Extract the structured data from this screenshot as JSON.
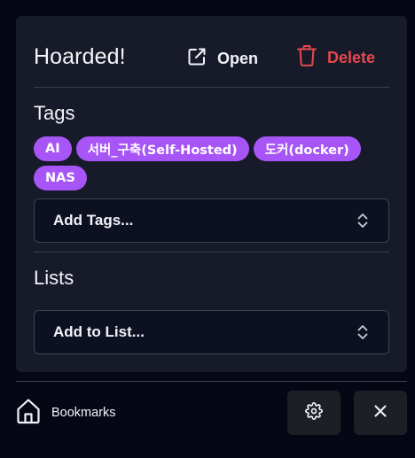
{
  "header": {
    "title": "Hoarded!",
    "open_label": "Open",
    "delete_label": "Delete"
  },
  "tags_section": {
    "title": "Tags",
    "tags": [
      "AI",
      "서버_구축(Self-Hosted)",
      "도커(docker)",
      "NAS"
    ],
    "add_placeholder": "Add Tags..."
  },
  "lists_section": {
    "title": "Lists",
    "add_placeholder": "Add to List..."
  },
  "footer": {
    "bookmarks_label": "Bookmarks"
  },
  "icons": {
    "open": "external-link-icon",
    "delete": "trash-icon",
    "select": "chevron-up-down-icon",
    "home": "home-icon",
    "settings": "gear-icon",
    "close": "close-icon"
  },
  "colors": {
    "tag_bg": "#a855f7",
    "delete": "#e5484d",
    "card_bg": "#171b29",
    "page_bg": "#050714"
  }
}
